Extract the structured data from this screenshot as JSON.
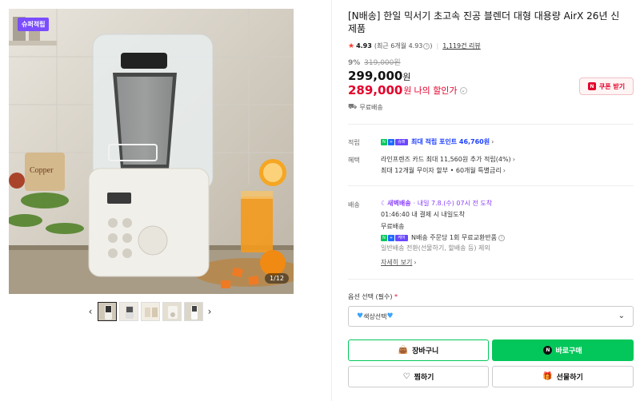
{
  "gallery": {
    "badge": "슈퍼적립",
    "counter": "1/12",
    "prev_icon": "chevron-left-icon",
    "next_icon": "chevron-right-icon",
    "thumbnail_count": 5
  },
  "product": {
    "title": "[N배송] 한일 믹서기 초고속 진공 블렌더 대형 대용량 AirX 26년 신제품",
    "rating": "4.93",
    "recent_rating": "(최근 6개월 4.93",
    "review_count": "1,119건 리뷰",
    "discount_rate": "9%",
    "original_price": "319,000원",
    "price": "299,000",
    "price_unit": "원",
    "my_price": "289,000",
    "my_price_unit": "원",
    "my_price_label": "나의 할인가",
    "coupon_label": "쿠폰 받기",
    "shipping": "무료배송"
  },
  "benefits": {
    "points_label": "적립",
    "points_badge_tag": "슈퍼",
    "points_text": "최대 적립 포인트 46,760원",
    "benefit_label": "혜택",
    "benefit_line1": "라인프렌즈 카드 최대 11,560원 추가 적립(4%)",
    "benefit_line2": "최대 12개월 무이자 할부 • 60개월 특별금리"
  },
  "delivery": {
    "label": "배송",
    "tag": "새벽배송",
    "arrival": "· 내일 7.8.(수) 07시 전 도착",
    "cutoff": "01:46:40  내 결제 시 내일도착",
    "fee": "무료배송",
    "return_badge_tag": "케어",
    "return_text": "N배송 주문당 1회 무료교환반품",
    "exclusion": "일반배송 전환(선물하기, 할배송 등) 제외",
    "more_link": "자세히 보기"
  },
  "options": {
    "label": "옵션 선택 (필수)",
    "required_mark": "*",
    "select_value": "색상선택"
  },
  "actions": {
    "cart": "장바구니",
    "buy": "바로구매",
    "wish": "찜하기",
    "gift": "선물하기"
  },
  "colors": {
    "naver_green": "#03c75a",
    "sale_red": "#e4002b",
    "point_blue": "#1e40ff",
    "super_purple": "#7b4dff"
  }
}
